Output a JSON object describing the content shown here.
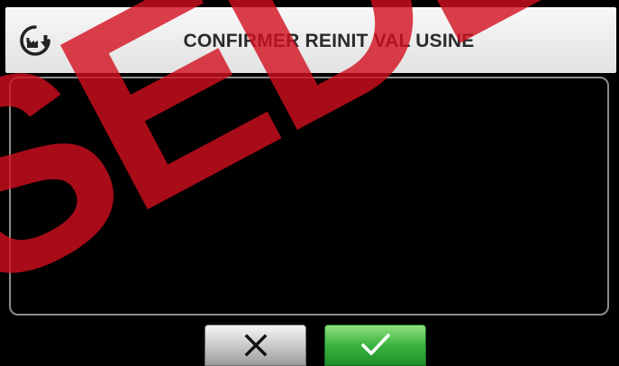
{
  "header": {
    "title": "CONFIRMER REINIT VAL USINE",
    "icon": "factory-reset-icon"
  },
  "buttons": {
    "cancel": {
      "icon": "close-icon"
    },
    "confirm": {
      "icon": "check-icon"
    }
  },
  "watermark": {
    "text": "SEDE",
    "color": "#d20f1e"
  },
  "colors": {
    "header_background": "#e9e9e9",
    "panel_border": "#8c8c8c",
    "confirm_green": "#3cb440",
    "cancel_grey": "#cfcfcf"
  }
}
